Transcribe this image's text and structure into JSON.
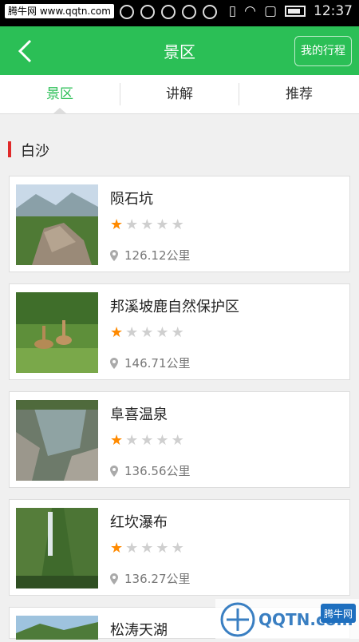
{
  "status_bar": {
    "watermark": "腾牛网 www.qqtn.com",
    "time": "12:37"
  },
  "header": {
    "back_label": "<",
    "title": "景区",
    "trip_button": "我的行程"
  },
  "tabs": [
    {
      "label": "景区",
      "active": true
    },
    {
      "label": "讲解",
      "active": false
    },
    {
      "label": "推荐",
      "active": false
    }
  ],
  "section": {
    "title": "白沙"
  },
  "spots": [
    {
      "name": "陨石坑",
      "rating": 1,
      "distance": "126.12公里",
      "thumb_icon": "mountain-rock-photo"
    },
    {
      "name": "邦溪坡鹿自然保护区",
      "rating": 1,
      "distance": "146.71公里",
      "thumb_icon": "deer-photo"
    },
    {
      "name": "阜喜温泉",
      "rating": 1,
      "distance": "136.56公里",
      "thumb_icon": "hot-spring-photo"
    },
    {
      "name": "红坎瀑布",
      "rating": 1,
      "distance": "136.27公里",
      "thumb_icon": "waterfall-photo"
    },
    {
      "name": "松涛天湖",
      "rating": null,
      "distance": "",
      "thumb_icon": "lake-photo"
    }
  ],
  "bottom_watermark": {
    "text": "QQTN.com",
    "badge": "腾牛网"
  },
  "colors": {
    "accent": "#2bbf56",
    "star_on": "#ff8a00",
    "star_off": "#cfcfcf",
    "section_bar": "#e02a2a"
  }
}
